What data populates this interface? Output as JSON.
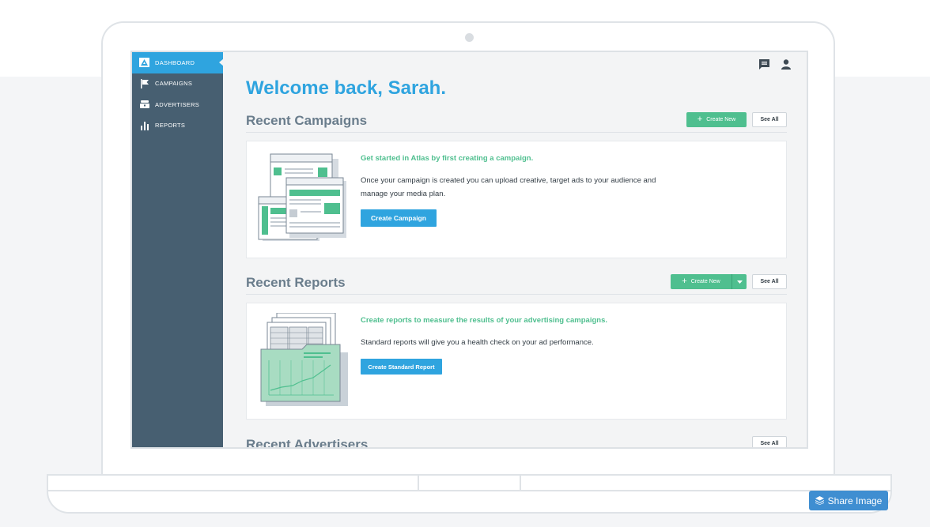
{
  "sidebar": {
    "items": [
      {
        "label": "DASHBOARD",
        "icon": "atlas-logo-icon",
        "active": true
      },
      {
        "label": "CAMPAIGNS",
        "icon": "flag-icon",
        "active": false
      },
      {
        "label": "ADVERTISERS",
        "icon": "briefcase-icon",
        "active": false
      },
      {
        "label": "REPORTS",
        "icon": "bar-chart-icon",
        "active": false
      }
    ]
  },
  "header": {
    "icons": [
      "chat-icon",
      "user-icon"
    ]
  },
  "main": {
    "welcome": "Welcome back, Sarah.",
    "campaigns": {
      "title": "Recent Campaigns",
      "create_label": "Create New",
      "see_all": "See All",
      "card_heading": "Get started in Atlas by first creating a campaign.",
      "card_text": "Once your campaign is created you can upload creative, target ads to your audience and manage your media plan.",
      "button": "Create Campaign"
    },
    "reports": {
      "title": "Recent Reports",
      "create_label": "Create New",
      "see_all": "See All",
      "card_heading": "Create reports to measure the results of your advertising campaigns.",
      "card_text": "Standard reports will give you a health check on your ad performance.",
      "button": "Create Standard Report"
    },
    "advertisers": {
      "title": "Recent Advertisers",
      "see_all": "See All"
    }
  },
  "share": {
    "label": "Share Image",
    "icon": "layers-icon"
  },
  "colors": {
    "accent_blue": "#2fa4df",
    "accent_green": "#4fbf8f",
    "sidebar": "#475f71"
  }
}
